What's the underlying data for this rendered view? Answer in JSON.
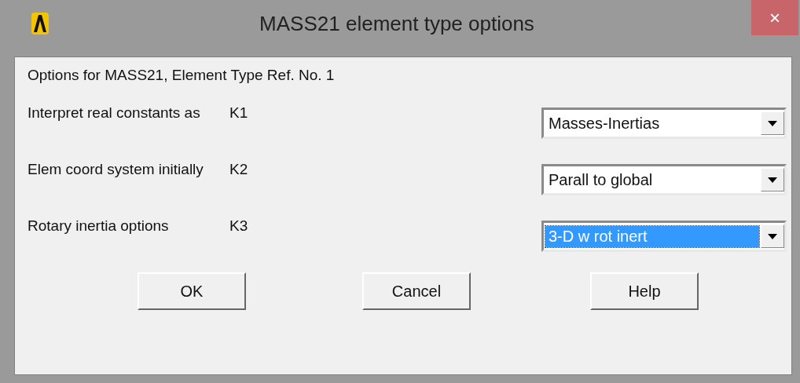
{
  "window": {
    "title": "MASS21 element type options",
    "close": "×"
  },
  "heading": "Options for MASS21, Element Type Ref. No. 1",
  "options": [
    {
      "label": "Interpret real constants as",
      "key": "K1",
      "value": "Masses-Inertias",
      "focused": false
    },
    {
      "label": "Elem coord system initially",
      "key": "K2",
      "value": "Parall to global",
      "focused": false
    },
    {
      "label": "Rotary inertia options",
      "key": "K3",
      "value": "3-D w rot inert",
      "focused": true
    }
  ],
  "buttons": [
    "OK",
    "Cancel",
    "Help"
  ]
}
